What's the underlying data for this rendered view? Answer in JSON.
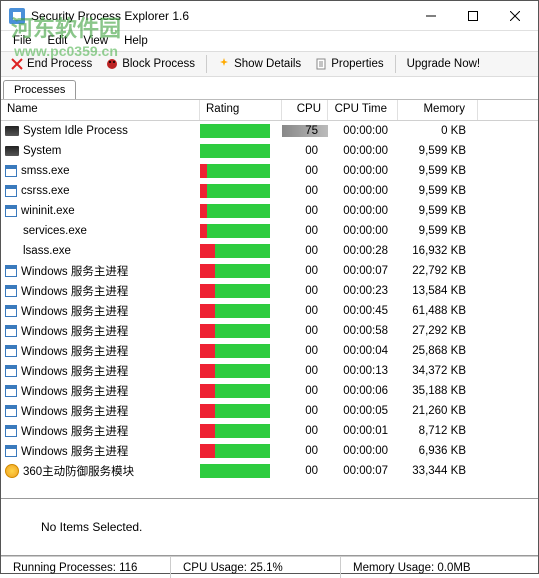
{
  "window": {
    "title": "Security Process Explorer 1.6"
  },
  "menu": {
    "file": "File",
    "edit": "Edit",
    "view": "View",
    "help": "Help"
  },
  "toolbar": {
    "end": "End Process",
    "block": "Block Process",
    "details": "Show Details",
    "props": "Properties",
    "upgrade": "Upgrade Now!"
  },
  "tabs": {
    "processes": "Processes"
  },
  "columns": {
    "name": "Name",
    "rating": "Rating",
    "cpu": "CPU",
    "cputime": "CPU Time",
    "memory": "Memory"
  },
  "watermark": {
    "line1": "河东软件园",
    "line2": "www.pc0359.cn"
  },
  "processes": [
    {
      "icon": "sys",
      "name": "System Idle Process",
      "red": 0,
      "cpu": "75",
      "cpu_hl": true,
      "time": "00:00:00",
      "mem": "0 KB"
    },
    {
      "icon": "sys",
      "name": "System",
      "red": 0,
      "cpu": "00",
      "time": "00:00:00",
      "mem": "9,599 KB"
    },
    {
      "icon": "app",
      "name": "smss.exe",
      "red": 10,
      "cpu": "00",
      "time": "00:00:00",
      "mem": "9,599 KB"
    },
    {
      "icon": "app",
      "name": "csrss.exe",
      "red": 10,
      "cpu": "00",
      "time": "00:00:00",
      "mem": "9,599 KB"
    },
    {
      "icon": "app",
      "name": "wininit.exe",
      "red": 10,
      "cpu": "00",
      "time": "00:00:00",
      "mem": "9,599 KB"
    },
    {
      "icon": "none",
      "name": "services.exe",
      "red": 10,
      "cpu": "00",
      "time": "00:00:00",
      "mem": "9,599 KB"
    },
    {
      "icon": "none",
      "name": "lsass.exe",
      "red": 22,
      "cpu": "00",
      "time": "00:00:28",
      "mem": "16,932 KB"
    },
    {
      "icon": "app",
      "name": "Windows 服务主进程",
      "red": 22,
      "cpu": "00",
      "time": "00:00:07",
      "mem": "22,792 KB"
    },
    {
      "icon": "app",
      "name": "Windows 服务主进程",
      "red": 22,
      "cpu": "00",
      "time": "00:00:23",
      "mem": "13,584 KB"
    },
    {
      "icon": "app",
      "name": "Windows 服务主进程",
      "red": 22,
      "cpu": "00",
      "time": "00:00:45",
      "mem": "61,488 KB"
    },
    {
      "icon": "app",
      "name": "Windows 服务主进程",
      "red": 22,
      "cpu": "00",
      "time": "00:00:58",
      "mem": "27,292 KB"
    },
    {
      "icon": "app",
      "name": "Windows 服务主进程",
      "red": 22,
      "cpu": "00",
      "time": "00:00:04",
      "mem": "25,868 KB"
    },
    {
      "icon": "app",
      "name": "Windows 服务主进程",
      "red": 22,
      "cpu": "00",
      "time": "00:00:13",
      "mem": "34,372 KB"
    },
    {
      "icon": "app",
      "name": "Windows 服务主进程",
      "red": 22,
      "cpu": "00",
      "time": "00:00:06",
      "mem": "35,188 KB"
    },
    {
      "icon": "app",
      "name": "Windows 服务主进程",
      "red": 22,
      "cpu": "00",
      "time": "00:00:05",
      "mem": "21,260 KB"
    },
    {
      "icon": "app",
      "name": "Windows 服务主进程",
      "red": 22,
      "cpu": "00",
      "time": "00:00:01",
      "mem": "8,712 KB"
    },
    {
      "icon": "app",
      "name": "Windows 服务主进程",
      "red": 22,
      "cpu": "00",
      "time": "00:00:00",
      "mem": "6,936 KB"
    },
    {
      "icon": "shield",
      "name": "360主动防御服务模块",
      "red": 0,
      "cpu": "00",
      "time": "00:00:07",
      "mem": "33,344 KB"
    }
  ],
  "detail": {
    "empty": "No Items Selected."
  },
  "status": {
    "running": "Running Processes: 116",
    "cpu": "CPU Usage: 25.1%",
    "mem": "Memory Usage: 0.0MB"
  }
}
